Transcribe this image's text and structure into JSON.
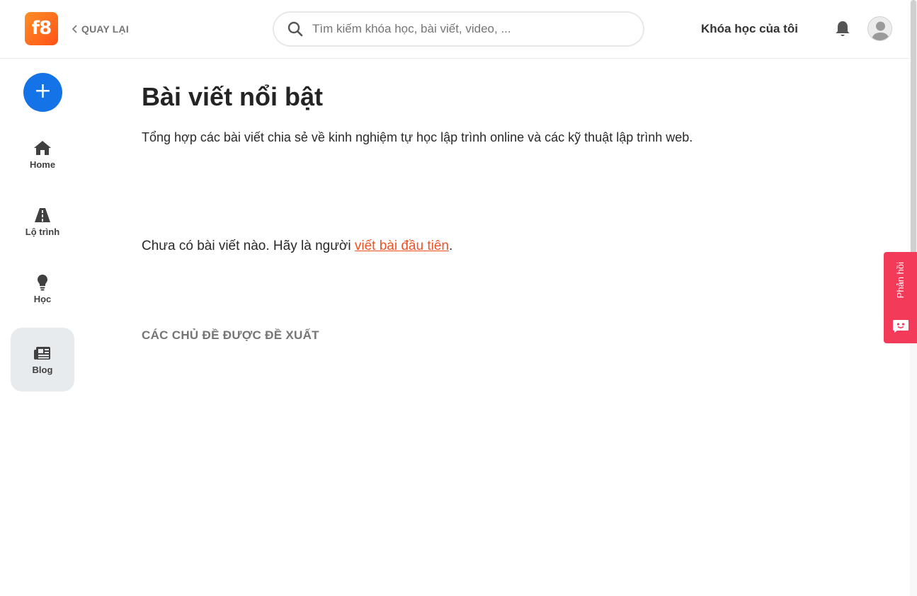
{
  "header": {
    "logo_text": "f8",
    "back_label": "QUAY LẠI",
    "search_placeholder": "Tìm kiếm khóa học, bài viết, video, ...",
    "my_courses_label": "Khóa học của tôi"
  },
  "sidebar": {
    "items": [
      {
        "label": "Home",
        "icon": "home-icon"
      },
      {
        "label": "Lộ trình",
        "icon": "road-icon"
      },
      {
        "label": "Học",
        "icon": "lightbulb-icon"
      },
      {
        "label": "Blog",
        "icon": "newspaper-icon",
        "active": true
      }
    ]
  },
  "main": {
    "title": "Bài viết nổi bật",
    "description": "Tổng hợp các bài viết chia sẻ về kinh nghiệm tự học lập trình online và các kỹ thuật lập trình web.",
    "empty_prefix": "Chưa có bài viết nào. Hãy là người ",
    "empty_link": "viết bài đầu tiên",
    "empty_suffix": ".",
    "topics_heading": "CÁC CHỦ ĐỀ ĐƯỢC ĐỀ XUẤT"
  },
  "feedback": {
    "label": "Phản hồi"
  },
  "colors": {
    "accent": "#f05123",
    "primary": "#1473e6",
    "feedback": "#f33a58",
    "active_bg": "#e8ebed"
  }
}
